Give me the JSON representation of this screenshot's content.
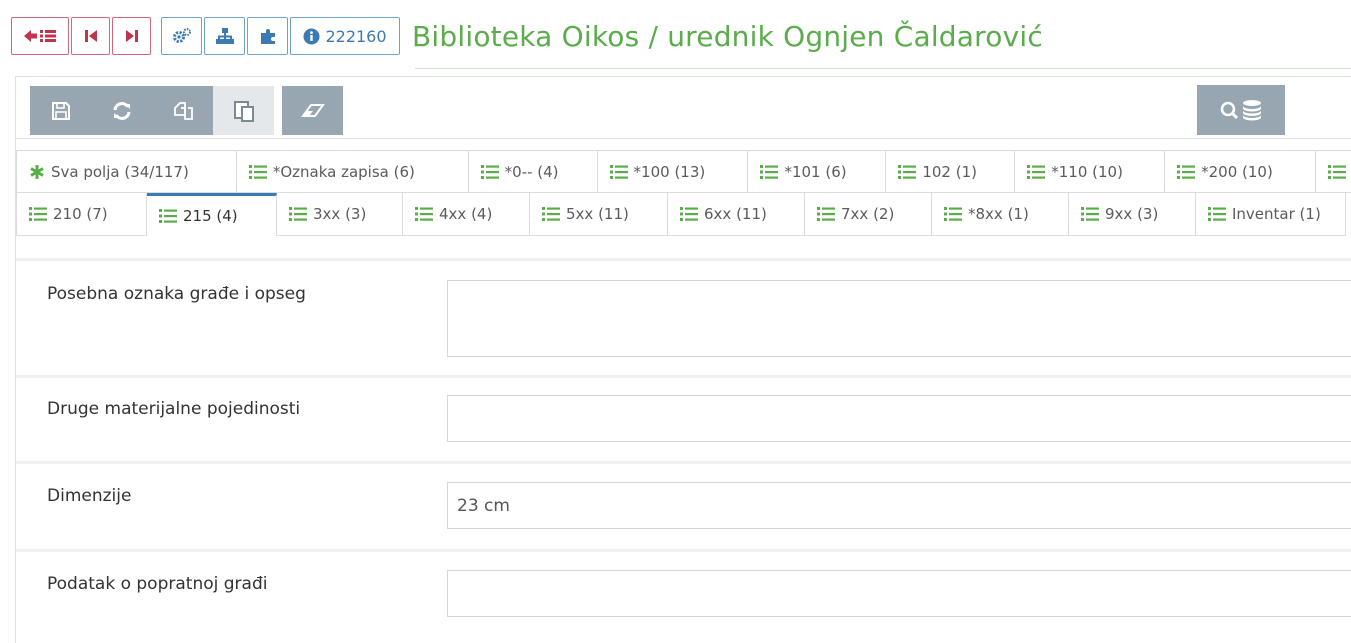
{
  "header": {
    "record_id": "222160",
    "title": "Biblioteka Oikos / urednik Ognjen Čaldarović"
  },
  "colors": {
    "accent_green": "#5aad4a",
    "accent_blue": "#3c7ab2",
    "nav_red": "#c0344e",
    "toolbar_gray": "#97a6b0"
  },
  "toolbar": {
    "icons": [
      "save-icon",
      "refresh-icon",
      "copy-icon",
      "paste-icon",
      "eraser-icon",
      "search-database-icon"
    ]
  },
  "tabs_row1": [
    {
      "label": "Sva polja (34/117)",
      "icon": "asterisk-icon"
    },
    {
      "label": "*Oznaka zapisa (6)",
      "icon": "list-icon"
    },
    {
      "label": "*0-- (4)",
      "icon": "list-icon"
    },
    {
      "label": "*100 (13)",
      "icon": "list-icon"
    },
    {
      "label": "*101 (6)",
      "icon": "list-icon"
    },
    {
      "label": "102 (1)",
      "icon": "list-icon"
    },
    {
      "label": "*110 (10)",
      "icon": "list-icon"
    },
    {
      "label": "*200 (10)",
      "icon": "list-icon"
    }
  ],
  "tabs_row2": [
    {
      "label": "210 (7)"
    },
    {
      "label": "215 (4)",
      "active": true
    },
    {
      "label": "3xx (3)"
    },
    {
      "label": "4xx (4)"
    },
    {
      "label": "5xx (11)"
    },
    {
      "label": "6xx (11)"
    },
    {
      "label": "7xx (2)"
    },
    {
      "label": "*8xx (1)"
    },
    {
      "label": "9xx (3)"
    },
    {
      "label": "Inventar (1)"
    }
  ],
  "fields": [
    {
      "label": "Posebna oznaka građe i opseg",
      "value": ""
    },
    {
      "label": "Druge materijalne pojedinosti",
      "value": ""
    },
    {
      "label": "Dimenzije",
      "value": "23 cm"
    },
    {
      "label": "Podatak o popratnoj građi",
      "value": ""
    }
  ]
}
